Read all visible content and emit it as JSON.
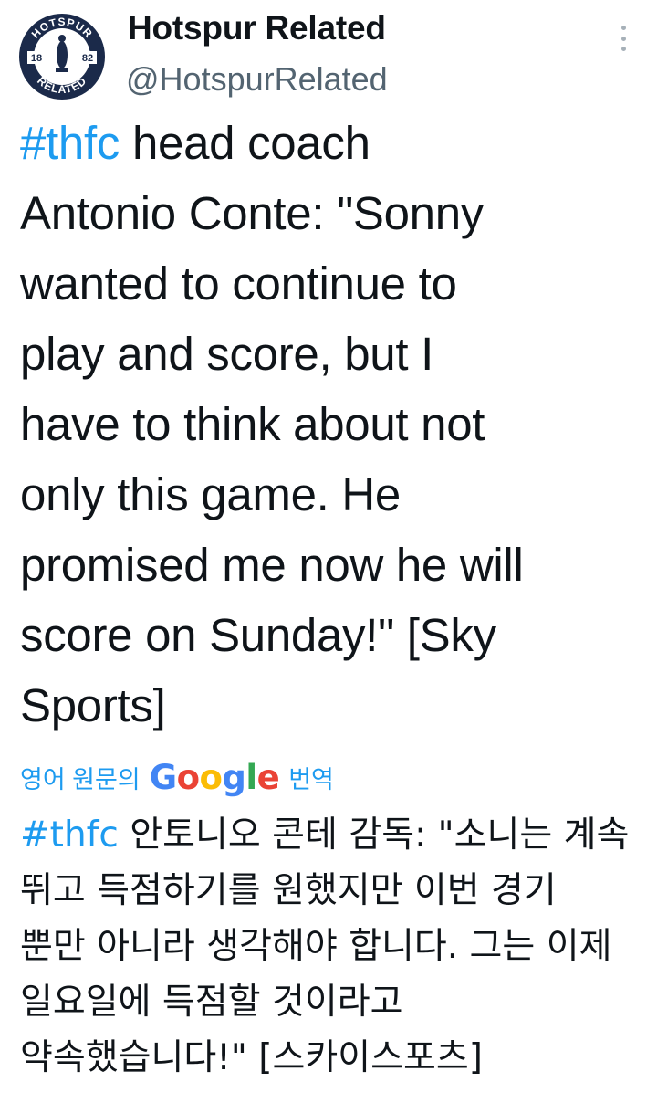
{
  "author": {
    "display_name": "Hotspur Related",
    "handle": "@HotspurRelated",
    "avatar": {
      "text_top": "HOTSPUR",
      "text_bottom": "RELATED",
      "year_left": "18",
      "year_right": "82",
      "colors": {
        "ring": "#1b2a4a",
        "inner": "#ffffff"
      }
    }
  },
  "menu": {
    "icon": "more-vertical-icon"
  },
  "tweet": {
    "hashtag": "#thfc",
    "lines": [
      " head coach",
      "Antonio Conte: \"Sonny",
      "wanted to continue to",
      "play and score, but I",
      "have to think about not",
      "only this game. He",
      "promised me now he will",
      "score on Sunday!\" [Sky",
      "Sports]"
    ]
  },
  "translation": {
    "label": "영어 원문의",
    "provider_letters": [
      "G",
      "o",
      "o",
      "g",
      "l",
      "e"
    ],
    "suffix": "번역",
    "hashtag": "#thfc",
    "lines": [
      " 안토니오 콘테 감독: \"소니는 계속",
      "뛰고 득점하기를 원했지만 이번 경기",
      "뿐만 아니라 생각해야 합니다. 그는 이제",
      "일요일에 득점할 것이라고",
      "약속했습니다!\" [스카이스포츠]"
    ]
  },
  "colors": {
    "hashtag": "#1d9bf0",
    "text": "#0f1419",
    "secondary": "#536471",
    "google_blue": "#4285f4",
    "google_red": "#ea4335",
    "google_yellow": "#fbbc05",
    "google_green": "#34a853"
  }
}
